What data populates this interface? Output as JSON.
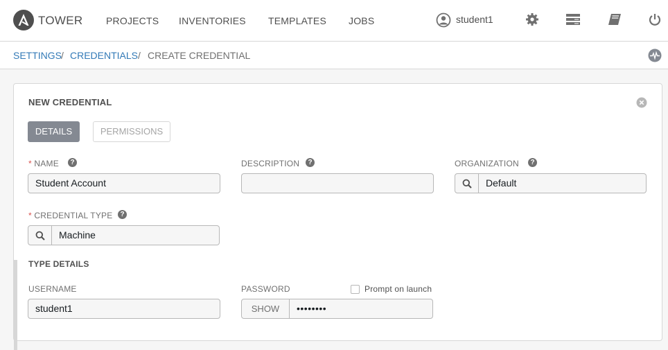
{
  "app": {
    "brand": "TOWER"
  },
  "nav": {
    "projects": "PROJECTS",
    "inventories": "INVENTORIES",
    "templates": "TEMPLATES",
    "jobs": "JOBS"
  },
  "user": {
    "name": "student1"
  },
  "icons": {
    "settings": "gear-icon",
    "portal": "portal-icon",
    "docs": "book-icon",
    "logout": "power-icon",
    "activity": "activity-stream-icon"
  },
  "breadcrumb": {
    "settings": "SETTINGS",
    "credentials": "CREDENTIALS",
    "current": "CREATE CREDENTIAL",
    "sep": "/"
  },
  "form": {
    "title": "NEW CREDENTIAL",
    "tabs": {
      "details": "DETAILS",
      "permissions": "PERMISSIONS"
    },
    "required_mark": "*",
    "name": {
      "label": "NAME",
      "value": "Student Account"
    },
    "description": {
      "label": "DESCRIPTION",
      "value": ""
    },
    "organization": {
      "label": "ORGANIZATION",
      "value": "Default"
    },
    "credential_type": {
      "label": "CREDENTIAL TYPE",
      "value": "Machine"
    },
    "type_details": {
      "title": "TYPE DETAILS"
    },
    "username": {
      "label": "USERNAME",
      "value": "student1"
    },
    "password": {
      "label": "PASSWORD",
      "show_label": "SHOW",
      "value": "••••••••",
      "prompt_label": "Prompt on launch"
    },
    "help_glyph": "?"
  },
  "colors": {
    "accent": "#337ab7",
    "active_tab": "#848992",
    "required": "#d9534f"
  }
}
